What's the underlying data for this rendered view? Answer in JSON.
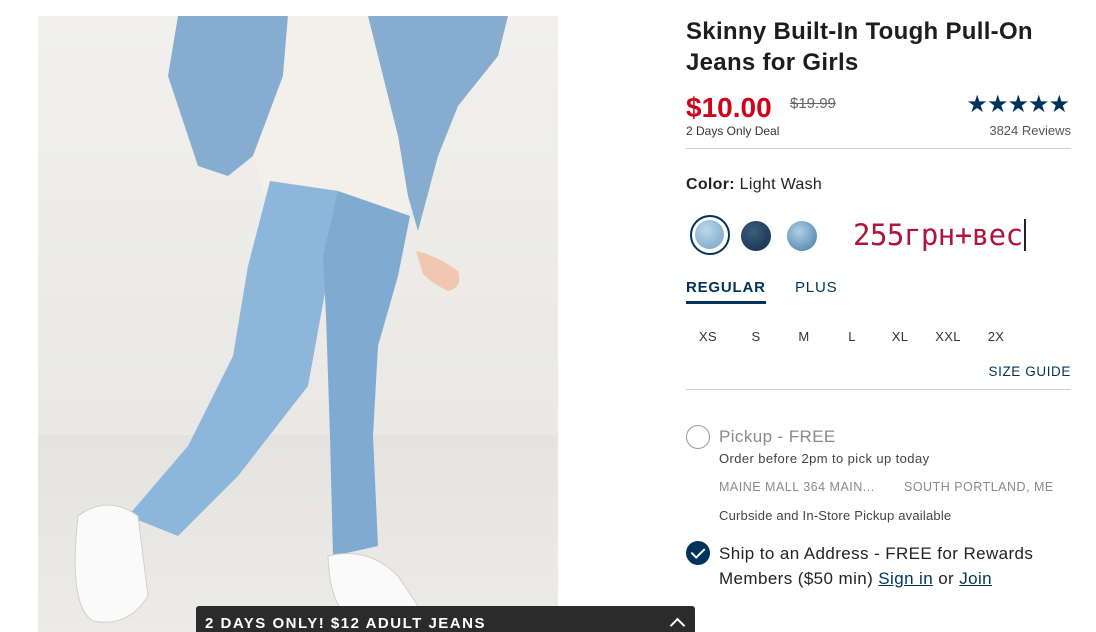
{
  "product": {
    "title": "Skinny Built-In Tough Pull-On Jeans for Girls",
    "price": "$10.00",
    "original_price": "$19.99",
    "deal_text": "2 Days Only Deal",
    "rating": 4.5,
    "rating_stars": "★★★★★",
    "reviews": "3824 Reviews"
  },
  "color": {
    "label": "Color:",
    "value": "Light Wash",
    "swatches": [
      {
        "name": "Light Wash",
        "selected": true,
        "hex": "#8fb7d2"
      },
      {
        "name": "Dark Wash",
        "selected": false,
        "hex": "#1c3a58"
      },
      {
        "name": "Medium Wash",
        "selected": false,
        "hex": "#5e8fb4"
      }
    ]
  },
  "annotation": "255грн+вес",
  "fit_tabs": [
    {
      "label": "REGULAR",
      "active": true
    },
    {
      "label": "PLUS",
      "active": false
    }
  ],
  "sizes": [
    "XS",
    "S",
    "M",
    "L",
    "XL",
    "XXL",
    "2X"
  ],
  "size_guide": "SIZE GUIDE",
  "pickup": {
    "title": "Pickup - FREE",
    "subtitle": "Order before 2pm to pick up today",
    "store": "MAINE MALL 364 MAIN...",
    "city": "SOUTH PORTLAND, ME",
    "note": "Curbside and In-Store Pickup available"
  },
  "ship": {
    "text": "Ship to an Address - FREE for Rewards Members ($50 min) ",
    "sign_in": "Sign in",
    "or": " or ",
    "join": "Join"
  },
  "promo_bar": {
    "text": "2 DAYS ONLY! $12 ADULT JEANS"
  },
  "colors": {
    "brand_navy": "#00335b",
    "sale_red": "#d0021b",
    "annotation_red": "#b0143a"
  }
}
